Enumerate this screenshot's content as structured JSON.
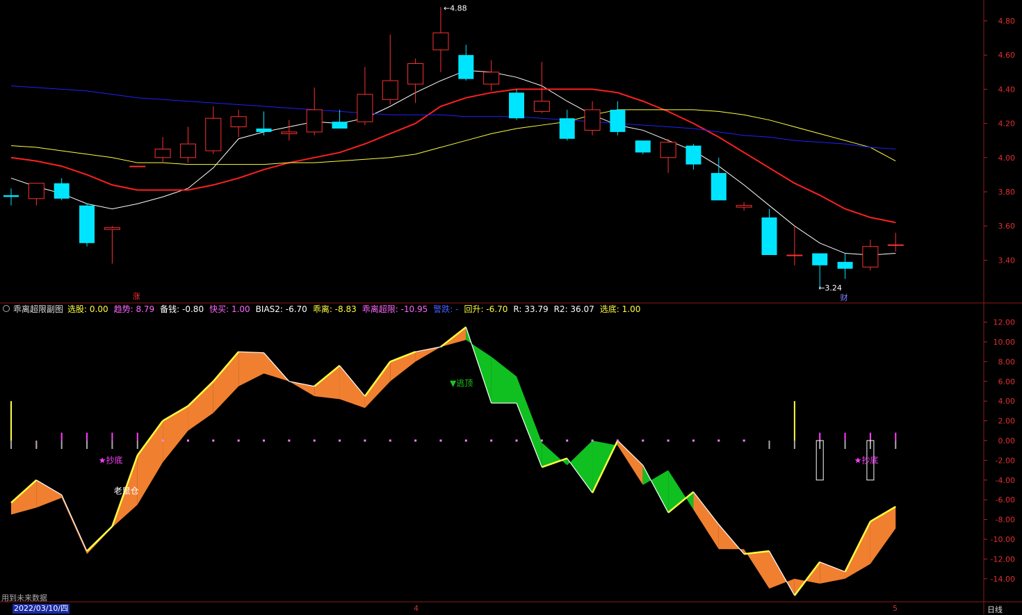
{
  "chart_data": [
    {
      "type": "candlestick",
      "y_ticks": [
        "4.80",
        "4.60",
        "4.40",
        "4.20",
        "4.00",
        "3.80",
        "3.60",
        "3.40"
      ],
      "ylim": [
        3.2,
        4.95
      ],
      "annotations": {
        "high_label": "4.88",
        "low_label": "3.24",
        "up_marker": "涨",
        "event_marker": "财"
      },
      "candles": [
        {
          "o": 3.78,
          "h": 3.82,
          "l": 3.72,
          "c": 3.77
        },
        {
          "o": 3.76,
          "h": 3.8,
          "l": 3.72,
          "c": 3.85
        },
        {
          "o": 3.85,
          "h": 3.88,
          "l": 3.75,
          "c": 3.76
        },
        {
          "o": 3.72,
          "h": 3.73,
          "l": 3.48,
          "c": 3.5
        },
        {
          "o": 3.58,
          "h": 3.6,
          "l": 3.38,
          "c": 3.59
        },
        {
          "o": 3.95,
          "h": 3.95,
          "l": 3.95,
          "c": 3.95
        },
        {
          "o": 4.0,
          "h": 4.12,
          "l": 3.97,
          "c": 4.05
        },
        {
          "o": 4.0,
          "h": 4.18,
          "l": 3.97,
          "c": 4.08
        },
        {
          "o": 4.04,
          "h": 4.3,
          "l": 4.02,
          "c": 4.23
        },
        {
          "o": 4.18,
          "h": 4.28,
          "l": 4.12,
          "c": 4.24
        },
        {
          "o": 4.17,
          "h": 4.27,
          "l": 4.13,
          "c": 4.15
        },
        {
          "o": 4.14,
          "h": 4.22,
          "l": 4.1,
          "c": 4.15
        },
        {
          "o": 4.15,
          "h": 4.41,
          "l": 4.13,
          "c": 4.28
        },
        {
          "o": 4.21,
          "h": 4.28,
          "l": 4.17,
          "c": 4.17
        },
        {
          "o": 4.21,
          "h": 4.53,
          "l": 4.19,
          "c": 4.37
        },
        {
          "o": 4.34,
          "h": 4.72,
          "l": 4.31,
          "c": 4.45
        },
        {
          "o": 4.43,
          "h": 4.58,
          "l": 4.32,
          "c": 4.55
        },
        {
          "o": 4.63,
          "h": 4.88,
          "l": 4.5,
          "c": 4.73
        },
        {
          "o": 4.6,
          "h": 4.66,
          "l": 4.45,
          "c": 4.46
        },
        {
          "o": 4.43,
          "h": 4.57,
          "l": 4.39,
          "c": 4.5
        },
        {
          "o": 4.38,
          "h": 4.4,
          "l": 4.22,
          "c": 4.23
        },
        {
          "o": 4.27,
          "h": 4.56,
          "l": 4.26,
          "c": 4.33
        },
        {
          "o": 4.23,
          "h": 4.28,
          "l": 4.1,
          "c": 4.11
        },
        {
          "o": 4.16,
          "h": 4.33,
          "l": 4.13,
          "c": 4.28
        },
        {
          "o": 4.28,
          "h": 4.33,
          "l": 4.13,
          "c": 4.15
        },
        {
          "o": 4.1,
          "h": 4.1,
          "l": 4.02,
          "c": 4.03
        },
        {
          "o": 4.0,
          "h": 4.11,
          "l": 3.91,
          "c": 4.09
        },
        {
          "o": 4.07,
          "h": 4.08,
          "l": 3.93,
          "c": 3.96
        },
        {
          "o": 3.91,
          "h": 4.0,
          "l": 3.75,
          "c": 3.75
        },
        {
          "o": 3.71,
          "h": 3.74,
          "l": 3.69,
          "c": 3.72
        },
        {
          "o": 3.65,
          "h": 3.7,
          "l": 3.43,
          "c": 3.43
        },
        {
          "o": 3.43,
          "h": 3.6,
          "l": 3.37,
          "c": 3.43
        },
        {
          "o": 3.44,
          "h": 3.44,
          "l": 3.24,
          "c": 3.37
        },
        {
          "o": 3.39,
          "h": 3.44,
          "l": 3.29,
          "c": 3.35
        },
        {
          "o": 3.36,
          "h": 3.52,
          "l": 3.34,
          "c": 3.48
        },
        {
          "o": 3.49,
          "h": 3.56,
          "l": 3.45,
          "c": 3.49
        }
      ],
      "ma": [
        {
          "color": "#ffffff",
          "values": [
            3.88,
            3.83,
            3.79,
            3.73,
            3.7,
            3.73,
            3.77,
            3.82,
            3.94,
            4.11,
            4.15,
            4.18,
            4.21,
            4.2,
            4.23,
            4.3,
            4.38,
            4.45,
            4.51,
            4.5,
            4.47,
            4.42,
            4.33,
            4.25,
            4.19,
            4.16,
            4.1,
            4.04,
            3.95,
            3.84,
            3.72,
            3.6,
            3.5,
            3.44,
            3.43,
            3.44
          ]
        },
        {
          "color": "#ff2020",
          "values": [
            4.0,
            3.98,
            3.95,
            3.9,
            3.84,
            3.81,
            3.81,
            3.81,
            3.84,
            3.88,
            3.93,
            3.97,
            4.0,
            4.03,
            4.08,
            4.14,
            4.2,
            4.3,
            4.35,
            4.38,
            4.4,
            4.4,
            4.4,
            4.4,
            4.38,
            4.33,
            4.27,
            4.2,
            4.12,
            4.03,
            3.94,
            3.85,
            3.78,
            3.7,
            3.65,
            3.62
          ]
        },
        {
          "color": "#ffff40",
          "values": [
            4.07,
            4.06,
            4.04,
            4.02,
            4.0,
            3.97,
            3.97,
            3.96,
            3.96,
            3.96,
            3.96,
            3.97,
            3.97,
            3.98,
            3.99,
            4.0,
            4.02,
            4.06,
            4.1,
            4.14,
            4.17,
            4.19,
            4.21,
            4.25,
            4.28,
            4.28,
            4.28,
            4.28,
            4.27,
            4.25,
            4.22,
            4.18,
            4.14,
            4.1,
            4.06,
            3.98
          ]
        },
        {
          "color": "#2020ff",
          "values": [
            4.42,
            4.41,
            4.4,
            4.39,
            4.37,
            4.35,
            4.34,
            4.33,
            4.32,
            4.31,
            4.3,
            4.29,
            4.28,
            4.27,
            4.26,
            4.25,
            4.25,
            4.25,
            4.24,
            4.24,
            4.24,
            4.23,
            4.22,
            4.21,
            4.2,
            4.19,
            4.18,
            4.17,
            4.15,
            4.13,
            4.12,
            4.1,
            4.09,
            4.08,
            4.06,
            4.05
          ]
        }
      ]
    },
    {
      "type": "indicator",
      "title": "乖离超限副图",
      "y_ticks": [
        "12.00",
        "10.00",
        "8.00",
        "6.00",
        "4.00",
        "2.00",
        "0.00",
        "-2.00",
        "-4.00",
        "-6.00",
        "-8.00",
        "-10.00",
        "-12.00",
        "-14.00"
      ],
      "ylim": [
        -16.0,
        12.8
      ],
      "legend": [
        {
          "label": "选股: 0.00",
          "color": "#ffff40"
        },
        {
          "label": "趋势: 8.79",
          "color": "#ff66ff"
        },
        {
          "label": "备钱: -0.80",
          "color": "#ffffff"
        },
        {
          "label": "快买: 1.00",
          "color": "#ff66ff"
        },
        {
          "label": "BIAS2: -6.70",
          "color": "#ffffff"
        },
        {
          "label": "乖离: -8.83",
          "color": "#ffff40"
        },
        {
          "label": "乖离超限: -10.95",
          "color": "#ff66ff"
        },
        {
          "label": "警跌: -",
          "color": "#4060ff"
        },
        {
          "label": "回升: -6.70",
          "color": "#ffff40"
        },
        {
          "label": "R: 33.79",
          "color": "#ffffff"
        },
        {
          "label": "R2: 36.07",
          "color": "#ffffff"
        },
        {
          "label": "选底: 1.00",
          "color": "#ffff40"
        }
      ],
      "bias2": [
        -6.3,
        -4.0,
        -5.5,
        -11.2,
        -8.7,
        -1.5,
        2.0,
        3.5,
        6.0,
        9.0,
        8.9,
        6.0,
        5.5,
        7.6,
        4.5,
        8.0,
        9.0,
        9.5,
        11.5,
        3.8,
        3.8,
        -2.7,
        -1.8,
        -5.3,
        0.0,
        -2.5,
        -7.3,
        -5.2,
        -8.5,
        -11.5,
        -11.2,
        -15.7,
        -12.3,
        -13.3,
        -8.2,
        -6.7
      ],
      "fill_line": [
        -7.5,
        -6.8,
        -5.8,
        -11.5,
        -8.8,
        -6.5,
        -2.2,
        1.0,
        2.8,
        5.5,
        6.8,
        6.0,
        4.5,
        4.2,
        3.3,
        6.0,
        8.0,
        9.5,
        10.2,
        8.5,
        6.5,
        -0.2,
        -2.5,
        0.0,
        -0.5,
        -4.5,
        -3.0,
        -7.0,
        -11.0,
        -11.0,
        -15.0,
        -14.0,
        -14.5,
        -14.0,
        -12.5,
        -8.9
      ],
      "signal_values": [
        4.0,
        -0.8,
        0.8,
        0.8,
        0.8,
        0.8,
        0.0,
        0.0,
        0.0,
        0.0,
        0.0,
        0.0,
        0.0,
        0.0,
        0.0,
        0.0,
        0.0,
        0.0,
        0.0,
        0.0,
        0.0,
        0.0,
        0.0,
        0.0,
        0.0,
        0.0,
        0.0,
        0.0,
        0.0,
        0.0,
        -0.8,
        4.0,
        0.8,
        0.8,
        0.8,
        0.8
      ],
      "box_columns": [
        32,
        34
      ],
      "box_range": [
        0.0,
        -4.0
      ],
      "labels": [
        {
          "text": "★抄底",
          "color": "#ff40ff",
          "x": 3.9,
          "y": -2.0
        },
        {
          "text": "老鼠仓",
          "color": "#ffffff",
          "x": 4.5,
          "y": -5.1
        },
        {
          "text": "▼逃顶",
          "color": "#20c020",
          "x": 17.8,
          "y": 5.8
        },
        {
          "text": "★抄底",
          "color": "#ff40ff",
          "x": 33.8,
          "y": -2.0
        }
      ]
    }
  ],
  "x_labels": {
    "date": "2022/03/10/四",
    "month_a": "4",
    "month_b": "5",
    "period": "日线"
  },
  "note": "用到未来数据"
}
